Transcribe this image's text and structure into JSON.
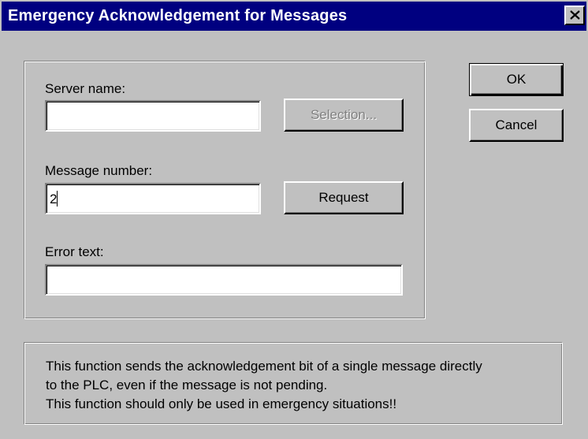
{
  "window": {
    "title": "Emergency Acknowledgement for Messages",
    "close_label": "Close"
  },
  "form": {
    "server_name_label": "Server name:",
    "server_name_value": "",
    "selection_button": "Selection...",
    "message_number_label": "Message number:",
    "message_number_value": "2",
    "request_button": "Request",
    "error_text_label": "Error text:",
    "error_text_value": ""
  },
  "buttons": {
    "ok": "OK",
    "cancel": "Cancel"
  },
  "info": {
    "line1": "This function sends the acknowledgement bit of a single message directly",
    "line2": "to the PLC, even if the message is not pending.",
    "line3": "This function should only be used in emergency situations!!"
  },
  "colors": {
    "titlebar": "#000080",
    "face": "#c0c0c0",
    "disabled_text": "#808080"
  }
}
